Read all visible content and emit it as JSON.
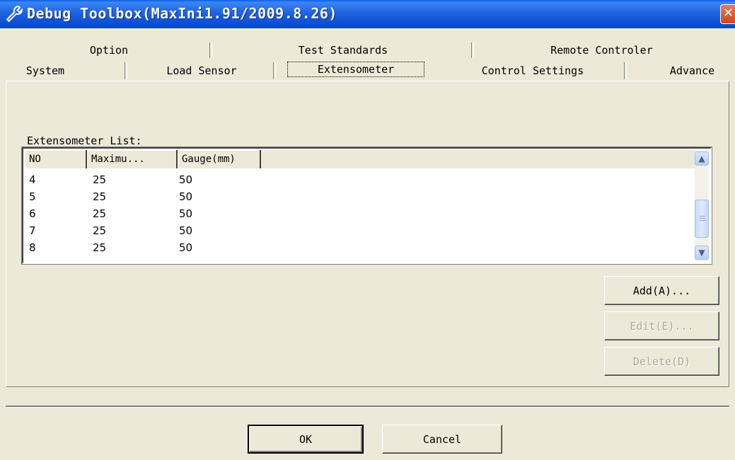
{
  "window": {
    "title": "Debug Toolbox(MaxIni1.91/2009.8.26)",
    "close_symbol": "✕"
  },
  "tabs": {
    "back_row": [
      "Option",
      "Test Standards",
      "Remote Controler"
    ],
    "front_row": [
      "System",
      "Load Sensor",
      "Extensometer",
      "Control Settings",
      "Advance"
    ],
    "active": "Extensometer"
  },
  "extensometer": {
    "list_label": "Extensometer List:",
    "columns": [
      "NO",
      "Maximu...",
      "Gauge(mm)"
    ],
    "rows": [
      [
        "4",
        "25",
        "50"
      ],
      [
        "5",
        "25",
        "50"
      ],
      [
        "6",
        "25",
        "50"
      ],
      [
        "7",
        "25",
        "50"
      ],
      [
        "8",
        "25",
        "50"
      ]
    ]
  },
  "scrollbar": {
    "up_symbol": "▲",
    "down_symbol": "▼"
  },
  "actions": {
    "add": "Add(A)...",
    "edit": "Edit(E)...",
    "delete": "Delete(D)"
  },
  "footer": {
    "ok": "OK",
    "cancel": "Cancel"
  }
}
